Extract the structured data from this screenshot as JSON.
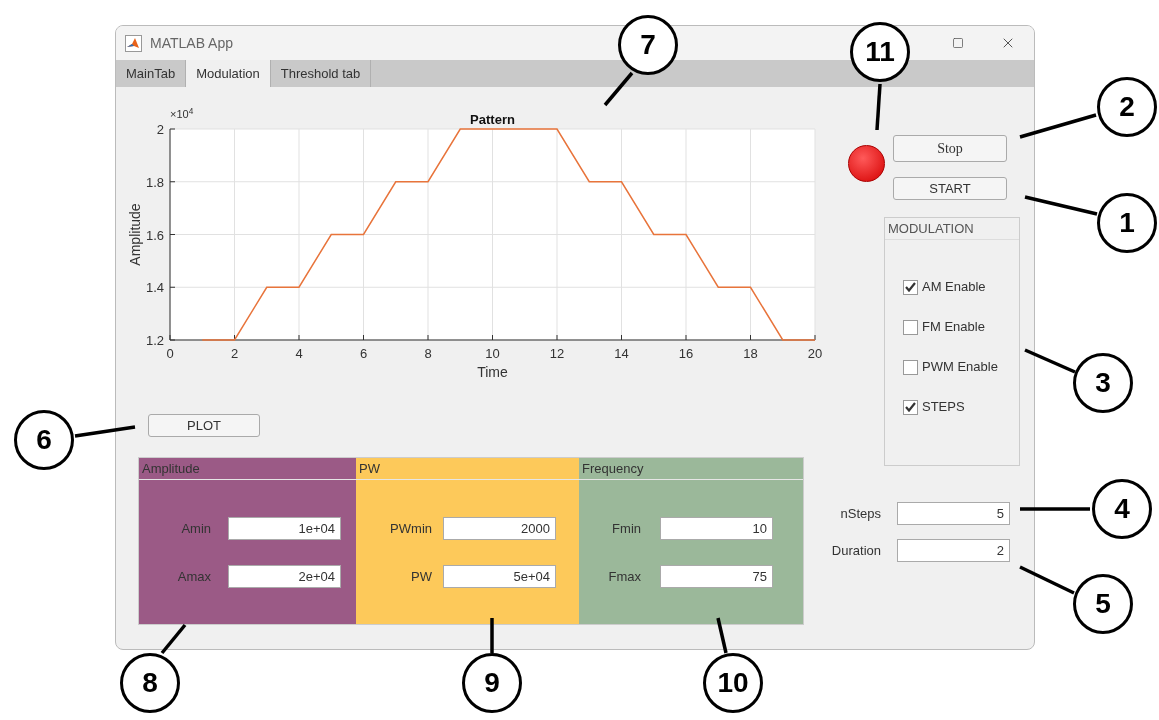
{
  "window": {
    "title": "MATLAB App"
  },
  "tabs": [
    {
      "label": "MainTab",
      "selected": false
    },
    {
      "label": "Modulation",
      "selected": true
    },
    {
      "label": "Threshold tab",
      "selected": false
    }
  ],
  "chart": {
    "exponent_label": "×10$^{4}$",
    "chart_data": {
      "type": "line",
      "title": "Pattern",
      "xlabel": "Time",
      "ylabel": "Amplitude",
      "x": [
        1,
        2,
        3,
        4,
        5,
        6,
        7,
        8,
        9,
        10,
        11,
        12,
        13,
        14,
        15,
        16,
        17,
        18,
        19,
        20
      ],
      "series": [
        {
          "color": "#e8743b",
          "values": [
            1.2,
            1.2,
            1.4,
            1.4,
            1.6,
            1.6,
            1.8,
            1.8,
            2,
            2,
            2,
            2,
            1.8,
            1.8,
            1.6,
            1.6,
            1.4,
            1.4,
            1.2,
            1.2
          ]
        }
      ],
      "xlim": [
        0,
        20
      ],
      "ylim": [
        1.2,
        2
      ],
      "xticks": [
        0,
        2,
        4,
        6,
        8,
        10,
        12,
        14,
        16,
        18,
        20
      ],
      "yticks": [
        1.2,
        1.4,
        1.6,
        1.8,
        2
      ],
      "grid": true
    }
  },
  "plot_button": "PLOT",
  "panels": [
    {
      "title": "Amplitude",
      "color": "#9b5a86",
      "fields": [
        {
          "label": "Amin",
          "value": "1e+04"
        },
        {
          "label": "Amax",
          "value": "2e+04"
        }
      ]
    },
    {
      "title": "PW",
      "color": "#fdc95a",
      "fields": [
        {
          "label": "PWmin",
          "value": "2000"
        },
        {
          "label": "PW",
          "value": "5e+04"
        }
      ]
    },
    {
      "title": "Frequency",
      "color": "#9bb89a",
      "fields": [
        {
          "label": "Fmin",
          "value": "10"
        },
        {
          "label": "Fmax",
          "value": "75"
        }
      ]
    }
  ],
  "lamp": {
    "on": true
  },
  "stop_button": "Stop",
  "start_button": "START",
  "modulation": {
    "title": "MODULATION",
    "options": [
      {
        "label": "AM Enable",
        "checked": true
      },
      {
        "label": "FM Enable",
        "checked": false
      },
      {
        "label": "PWM Enable",
        "checked": false
      },
      {
        "label": "STEPS",
        "checked": true
      }
    ]
  },
  "settings": [
    {
      "label": "nSteps",
      "value": "5"
    },
    {
      "label": "Duration",
      "value": "2"
    }
  ],
  "callouts": [
    "7",
    "11",
    "2",
    "1",
    "3",
    "4",
    "5",
    "6",
    "8",
    "9",
    "10"
  ]
}
